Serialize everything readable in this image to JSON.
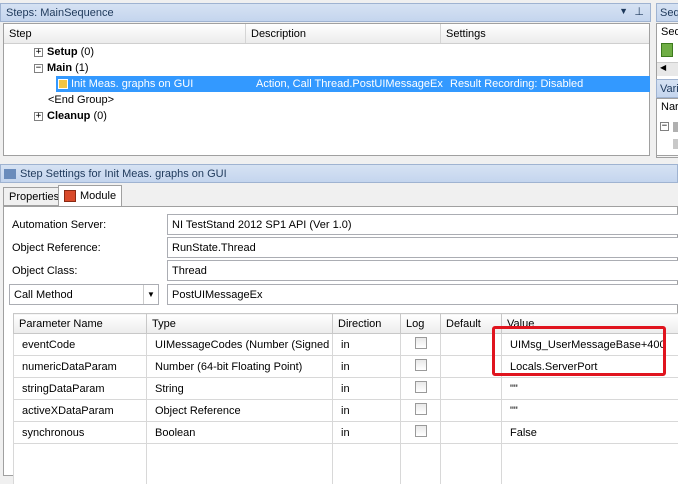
{
  "steps_pane": {
    "title": "Steps: MainSequence",
    "columns": [
      "Step",
      "Description",
      "Settings"
    ],
    "groups": [
      {
        "label": "Setup",
        "count": "(0)"
      },
      {
        "label": "Main",
        "count": "(1)"
      },
      {
        "label": "Cleanup",
        "count": "(0)"
      }
    ],
    "selected_step": {
      "name": "Init Meas. graphs on GUI",
      "description": "Action,  Call Thread.PostUIMessageEx",
      "settings": "Result Recording: Disabled"
    },
    "end_group": "<End Group>"
  },
  "side_panes": {
    "top_title": "Sequ",
    "top_label": "Seq",
    "bottom_title": "Varia",
    "bottom_label": "Nar"
  },
  "step_settings": {
    "title": "Step Settings for Init Meas. graphs on GUI",
    "tabs": [
      "Properties",
      "Module"
    ],
    "active_tab": "Module"
  },
  "module": {
    "automation_server_label": "Automation Server:",
    "automation_server": "NI TestStand 2012 SP1 API (Ver 1.0)",
    "object_reference_label": "Object Reference:",
    "object_reference": "RunState.Thread",
    "object_class_label": "Object Class:",
    "object_class": "Thread",
    "call_type": "Call Method",
    "method": "PostUIMessageEx"
  },
  "params": {
    "columns": [
      "Parameter Name",
      "Type",
      "Direction",
      "Log",
      "Default",
      "Value"
    ],
    "rows": [
      {
        "name": "eventCode",
        "type": "UIMessageCodes (Number (Signed 32...",
        "direction": "in",
        "value": "UIMsg_UserMessageBase+400"
      },
      {
        "name": "numericDataParam",
        "type": "Number (64-bit Floating Point)",
        "direction": "in",
        "value": "Locals.ServerPort"
      },
      {
        "name": "stringDataParam",
        "type": "String",
        "direction": "in",
        "value": "\"\""
      },
      {
        "name": "activeXDataParam",
        "type": "Object Reference",
        "direction": "in",
        "value": "\"\""
      },
      {
        "name": "synchronous",
        "type": "Boolean",
        "direction": "in",
        "value": "False"
      }
    ]
  },
  "highlight_color": "#e0141e",
  "selection_color": "#3399ff"
}
